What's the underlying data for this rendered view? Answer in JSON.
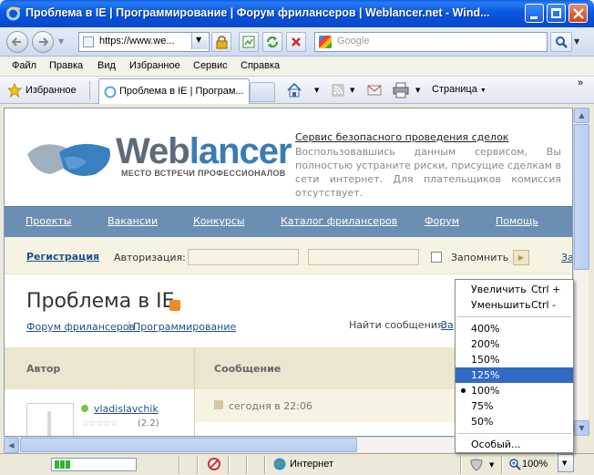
{
  "window": {
    "title": "Проблема в IE | Программирование | Форум фрилансеров | Weblancer.net - Wind..."
  },
  "navbar": {
    "address": "https://www.we...",
    "search_placeholder": "Google"
  },
  "menubar": {
    "items": [
      "Файл",
      "Правка",
      "Вид",
      "Избранное",
      "Сервис",
      "Справка"
    ]
  },
  "favbar": {
    "favorites_label": "Избранное",
    "tab_title": "Проблема в IE | Програм...",
    "page_menu": "Страница",
    "chevron": "»"
  },
  "page": {
    "logo": {
      "word_a": "Web",
      "word_b": "lancer",
      "tagline": "МЕСТО ВСТРЕЧИ ПРОФЕССИОНАЛОВ"
    },
    "service": {
      "title": "Сервис безопасного проведения сделок",
      "text": "Воспользовавшись данным сервисом, Вы полностью устраните риски, присущие сделкам в сети интернет. Для плательщиков комиссия отсутствует."
    },
    "nav": [
      "Проекты",
      "Вакансии",
      "Конкурсы",
      "Каталог фрилансеров",
      "Форум",
      "Помощь"
    ],
    "auth": {
      "register": "Регистрация",
      "label": "Авторизация:",
      "remember": "Запомнить",
      "trailing": "За"
    },
    "title": "Проблема в IE",
    "breadcrumb": [
      "Форум фрилансеров",
      "Программирование"
    ],
    "breadcrumb_sep": "|",
    "find": {
      "label": "Найти сообщения:",
      "link": "За"
    },
    "table": {
      "col_author": "Автор",
      "col_message": "Сообщение",
      "author": "vladislavchik",
      "stars": "☆☆☆☆☆",
      "rating": "(2.2)",
      "time": "сегодня в 22:06"
    }
  },
  "zoom_menu": {
    "zoom_in": "Увеличить",
    "zoom_in_sc": "Ctrl +",
    "zoom_out": "Уменьшить",
    "zoom_out_sc": "Ctrl -",
    "levels": [
      "400%",
      "200%",
      "150%",
      "125%",
      "100%",
      "75%",
      "50%"
    ],
    "selected": "125%",
    "current": "100%",
    "custom": "Особый..."
  },
  "statusbar": {
    "zone": "Интернет",
    "zoom": "100%"
  },
  "colors": {
    "titlebar": "#0a58de",
    "page_nav": "#6b8fb3",
    "link": "#1e4f8c",
    "menu_highlight": "#316ac5"
  }
}
